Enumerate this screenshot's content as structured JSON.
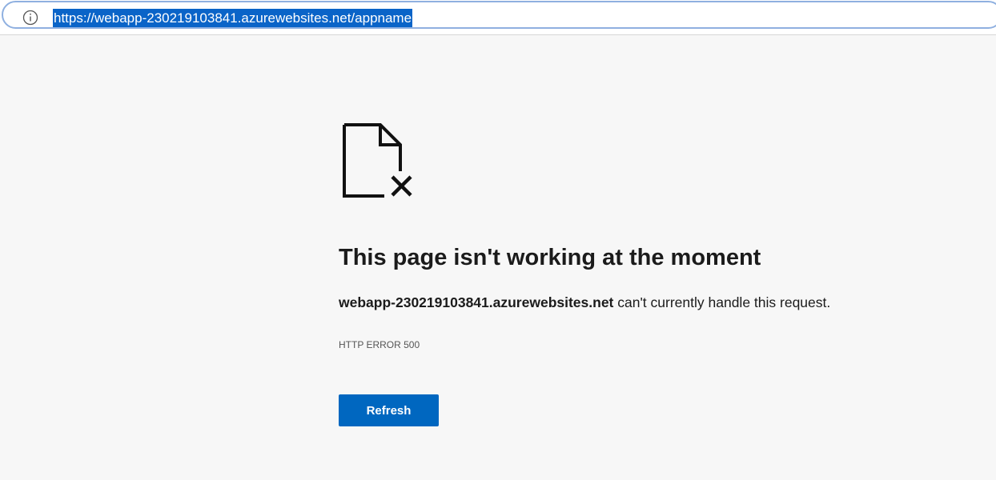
{
  "address_bar": {
    "url": "https://webapp-230219103841.azurewebsites.net/appname",
    "info_icon": "info-icon"
  },
  "error_page": {
    "icon": "broken-document-icon",
    "title": "This page isn't working at the moment",
    "host": "webapp-230219103841.azurewebsites.net",
    "message_suffix": " can't currently handle this request.",
    "error_code": "HTTP ERROR 500",
    "refresh_label": "Refresh"
  },
  "colors": {
    "accent": "#0067c0",
    "url_highlight": "#0a64c8",
    "background": "#f7f7f7"
  }
}
